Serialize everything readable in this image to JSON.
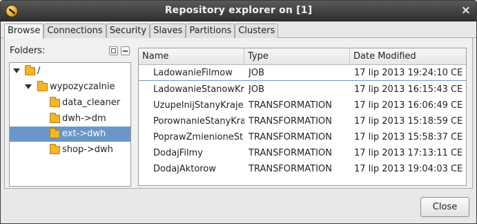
{
  "window": {
    "title": "Repository explorer on [1]",
    "close_glyph": "×",
    "icon": "app-icon"
  },
  "tabs": [
    {
      "label": "Browse",
      "active": true
    },
    {
      "label": "Connections",
      "active": false
    },
    {
      "label": "Security",
      "active": false
    },
    {
      "label": "Slaves",
      "active": false
    },
    {
      "label": "Partitions",
      "active": false
    },
    {
      "label": "Clusters",
      "active": false
    }
  ],
  "folders": {
    "label": "Folders:",
    "tree": [
      {
        "label": "/",
        "expanded": true,
        "selected": false
      },
      {
        "label": "wypozyczalnie",
        "expanded": true,
        "selected": false
      },
      {
        "label": "data_cleaner",
        "selected": false
      },
      {
        "label": "dwh->dm",
        "selected": false
      },
      {
        "label": "ext->dwh",
        "selected": true
      },
      {
        "label": "shop->dwh",
        "selected": false
      }
    ]
  },
  "table": {
    "columns": [
      "Name",
      "Type",
      "Date Modified"
    ],
    "rows": [
      {
        "name": "LadowanieFilmow",
        "type": "JOB",
        "date": "17 lip 2013 19:24:10 CE"
      },
      {
        "name": "LadowanieStanowKr",
        "type": "JOB",
        "date": "17 lip 2013 16:15:43 CE"
      },
      {
        "name": "UzupelnijStanyKraje",
        "type": "TRANSFORMATION",
        "date": "17 lip 2013 16:06:49 CE"
      },
      {
        "name": "PorownanieStanyKra",
        "type": "TRANSFORMATION",
        "date": "17 lip 2013 15:18:59 CE"
      },
      {
        "name": "PoprawZmienioneSt",
        "type": "TRANSFORMATION",
        "date": "17 lip 2013 15:58:37 CE"
      },
      {
        "name": "DodajFilmy",
        "type": "TRANSFORMATION",
        "date": "17 lip 2013 17:13:11 CE"
      },
      {
        "name": "DodajAktorow",
        "type": "TRANSFORMATION",
        "date": "17 lip 2013 19:04:03 CE"
      }
    ]
  },
  "footer": {
    "close_label": "Close"
  },
  "colors": {
    "selection": "#6b97c8",
    "titlebar": "#3d3d3d",
    "folder": "#f5b52a"
  }
}
